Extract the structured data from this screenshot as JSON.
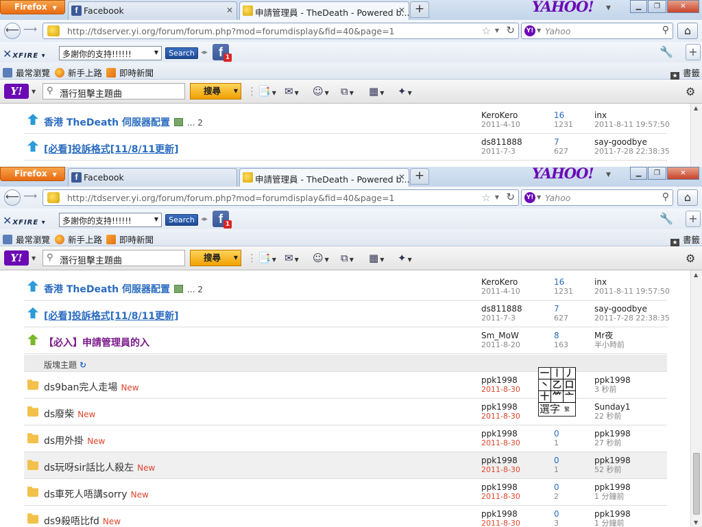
{
  "browser": {
    "menu_label": "Firefox",
    "tabs": [
      {
        "title": "Facebook",
        "icon": "facebook-icon"
      },
      {
        "title": "申請管理員 - TheDeath - Powered b...",
        "icon": "thedeath-site-icon"
      }
    ],
    "brand_logo": "YAHOO!",
    "url": "http://tdserver.yi.org/forum/forum.php?mod=forumdisplay&fid=40&page=1",
    "search_placeholder": "Yahoo"
  },
  "xfire_toolbar": {
    "logo": "XFIRE",
    "select_value": "多謝你的支持!!!!!!",
    "search_label": "Search",
    "notification_count": "1"
  },
  "bookmarks": {
    "items": [
      "最常瀏覽",
      "新手上路",
      "即時新聞"
    ],
    "right_label": "書籤"
  },
  "yahoo_toolbar": {
    "logo": "Y!",
    "search_value": "潛行狙擊主題曲",
    "search_button": "搜尋"
  },
  "forum": {
    "top_threads": [
      {
        "title": "香港 TheDeath 伺服器配置",
        "style": "blue",
        "pages": "... 2",
        "author": "KeroKero",
        "date": "2011-4-10",
        "replies": "16",
        "views": "1231",
        "last_user": "inx",
        "last_time": "2011-8-11 19:57:50"
      },
      {
        "title": "[必看]投訴格式[11/8/11更新]",
        "style": "link",
        "pages": "",
        "author": "ds811888",
        "date": "2011-7-3",
        "replies": "7",
        "views": "627",
        "last_user": "say-goodbye",
        "last_time": "2011-7-28 22:38:35"
      },
      {
        "title": "【必入】申請管理員的入",
        "style": "purple",
        "pages": "",
        "author": "Sm_MoW",
        "date": "2011-8-20",
        "replies": "8",
        "views": "163",
        "last_user": "Mr夜",
        "last_time": "半小時前"
      }
    ],
    "section_header": "版塊主題",
    "new_label": "New",
    "normal_threads": [
      {
        "title": "ds9ban完人走場",
        "author": "ppk1998",
        "date": "2011-8-30",
        "replies": "",
        "views": "",
        "last_user": "ppk1998",
        "last_time": "3 秒前"
      },
      {
        "title": "ds廢柴",
        "author": "ppk1998",
        "date": "2011-8-30",
        "replies": "",
        "views": "",
        "last_user": "Sunday1",
        "last_time": "22 秒前"
      },
      {
        "title": "ds用外掛",
        "author": "ppk1998",
        "date": "2011-8-30",
        "replies": "0",
        "views": "1",
        "last_user": "ppk1998",
        "last_time": "27 秒前"
      },
      {
        "title": "ds玩呀sir話比人殺左",
        "author": "ppk1998",
        "date": "2011-8-30",
        "replies": "0",
        "views": "1",
        "last_user": "ppk1998",
        "last_time": "52 秒前"
      },
      {
        "title": "ds車死人唔講sorry",
        "author": "ppk1998",
        "date": "2011-8-30",
        "replies": "0",
        "views": "2",
        "last_user": "ppk1998",
        "last_time": "1 分鐘前"
      },
      {
        "title": "ds9殺唔比fd",
        "author": "ppk1998",
        "date": "2011-8-30",
        "replies": "0",
        "views": "3",
        "last_user": "ppk1998",
        "last_time": "1 分鐘前"
      }
    ]
  },
  "ime_popup": {
    "cells": [
      "一",
      "丨",
      "丿",
      "丶",
      "乙",
      "口",
      "十",
      "⺮",
      "亠"
    ],
    "label": "選字",
    "sub": "繁"
  }
}
